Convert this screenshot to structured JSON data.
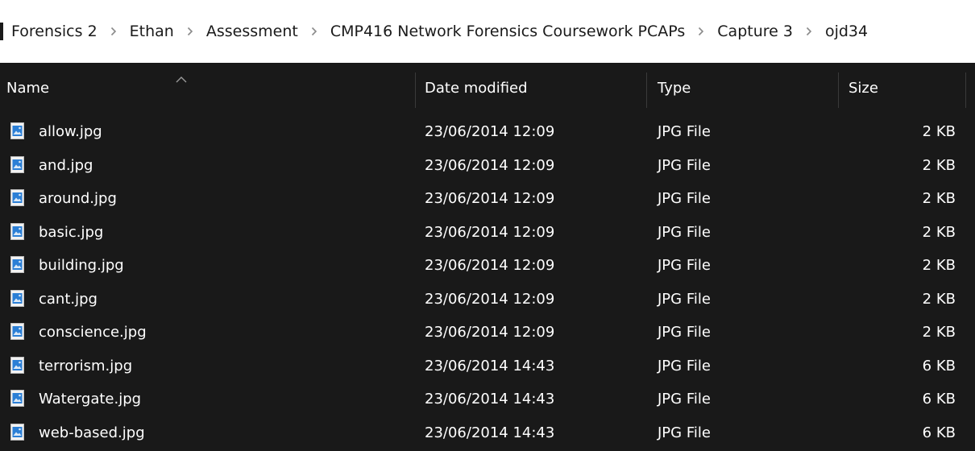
{
  "breadcrumb": [
    {
      "label": "Forensics 2"
    },
    {
      "label": "Ethan"
    },
    {
      "label": "Assessment"
    },
    {
      "label": "CMP416 Network Forensics Coursework PCAPs"
    },
    {
      "label": "Capture 3"
    },
    {
      "label": "ojd34"
    }
  ],
  "columns": {
    "name": "Name",
    "date_modified": "Date modified",
    "type": "Type",
    "size": "Size"
  },
  "sort": {
    "column": "name",
    "direction": "ascending"
  },
  "files": [
    {
      "name": "allow.jpg",
      "date": "23/06/2014 12:09",
      "type": "JPG File",
      "size": "2 KB"
    },
    {
      "name": "and.jpg",
      "date": "23/06/2014 12:09",
      "type": "JPG File",
      "size": "2 KB"
    },
    {
      "name": "around.jpg",
      "date": "23/06/2014 12:09",
      "type": "JPG File",
      "size": "2 KB"
    },
    {
      "name": "basic.jpg",
      "date": "23/06/2014 12:09",
      "type": "JPG File",
      "size": "2 KB"
    },
    {
      "name": "building.jpg",
      "date": "23/06/2014 12:09",
      "type": "JPG File",
      "size": "2 KB"
    },
    {
      "name": "cant.jpg",
      "date": "23/06/2014 12:09",
      "type": "JPG File",
      "size": "2 KB"
    },
    {
      "name": "conscience.jpg",
      "date": "23/06/2014 12:09",
      "type": "JPG File",
      "size": "2 KB"
    },
    {
      "name": "terrorism.jpg",
      "date": "23/06/2014 14:43",
      "type": "JPG File",
      "size": "6 KB"
    },
    {
      "name": "Watergate.jpg",
      "date": "23/06/2014 14:43",
      "type": "JPG File",
      "size": "6 KB"
    },
    {
      "name": "web-based.jpg",
      "date": "23/06/2014 14:43",
      "type": "JPG File",
      "size": "6 KB"
    }
  ],
  "icons": {
    "file": "image-file-icon",
    "separator": "chevron-right-icon",
    "sort": "sort-ascending-icon"
  },
  "colors": {
    "background": "#191919",
    "breadcrumb_bg": "#ffffff",
    "text": "#ffffff",
    "file_icon_blue": "#2b7fd6"
  }
}
